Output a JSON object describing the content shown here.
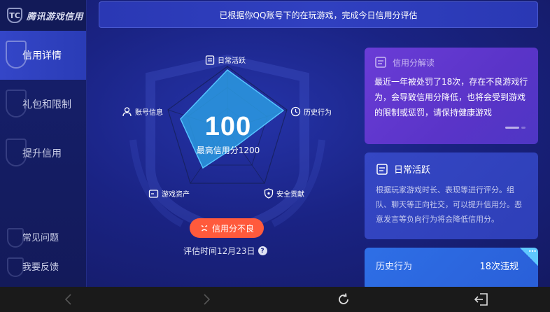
{
  "brand": {
    "name": "腾讯游戏信用",
    "logo_text": "TC"
  },
  "sidebar": {
    "items": [
      {
        "label": "信用详情",
        "active": true
      },
      {
        "label": "礼包和限制",
        "active": false
      },
      {
        "label": "提升信用",
        "active": false
      }
    ],
    "bottom_items": [
      {
        "label": "常见问题"
      },
      {
        "label": "我要反馈"
      }
    ]
  },
  "banner": {
    "text": "已根据你QQ账号下的在玩游戏，完成今日信用分评估"
  },
  "radar": {
    "axes": [
      "日常活跃",
      "历史行为",
      "安全贡献",
      "游戏资产",
      "账号信息"
    ],
    "score": "100",
    "max_label": "最高信用分1200",
    "status": "信用分不良",
    "eval_time": "评估时间12月23日",
    "help_icon": "?"
  },
  "cards": {
    "interpret": {
      "title": "信用分解读",
      "body": "最近一年被处罚了18次，存在不良游戏行为，会导致信用分降低，也将会受到游戏的限制或惩罚，请保持健康游戏"
    },
    "daily": {
      "title": "日常活跃",
      "body": "根据玩家游戏时长、表现等进行评分。组队、聊天等正向社交，可以提升信用分。恶意发言等负向行为将会降低信用分。"
    },
    "history": {
      "label": "历史行为",
      "value": "18次违规",
      "corner": "•••"
    }
  },
  "colors": {
    "background": "#1a2384",
    "active_nav": "#3446c8",
    "status_pill": "#ff5a3c",
    "card_purple": "#5a34c8",
    "card_blue": "#2e3fb8",
    "card_bright": "#2e6fe6",
    "radar_fill": "#2a9ae0"
  },
  "navbar": {
    "icons": [
      "chevron-left-icon",
      "chevron-right-icon",
      "refresh-icon",
      "exit-icon"
    ]
  }
}
